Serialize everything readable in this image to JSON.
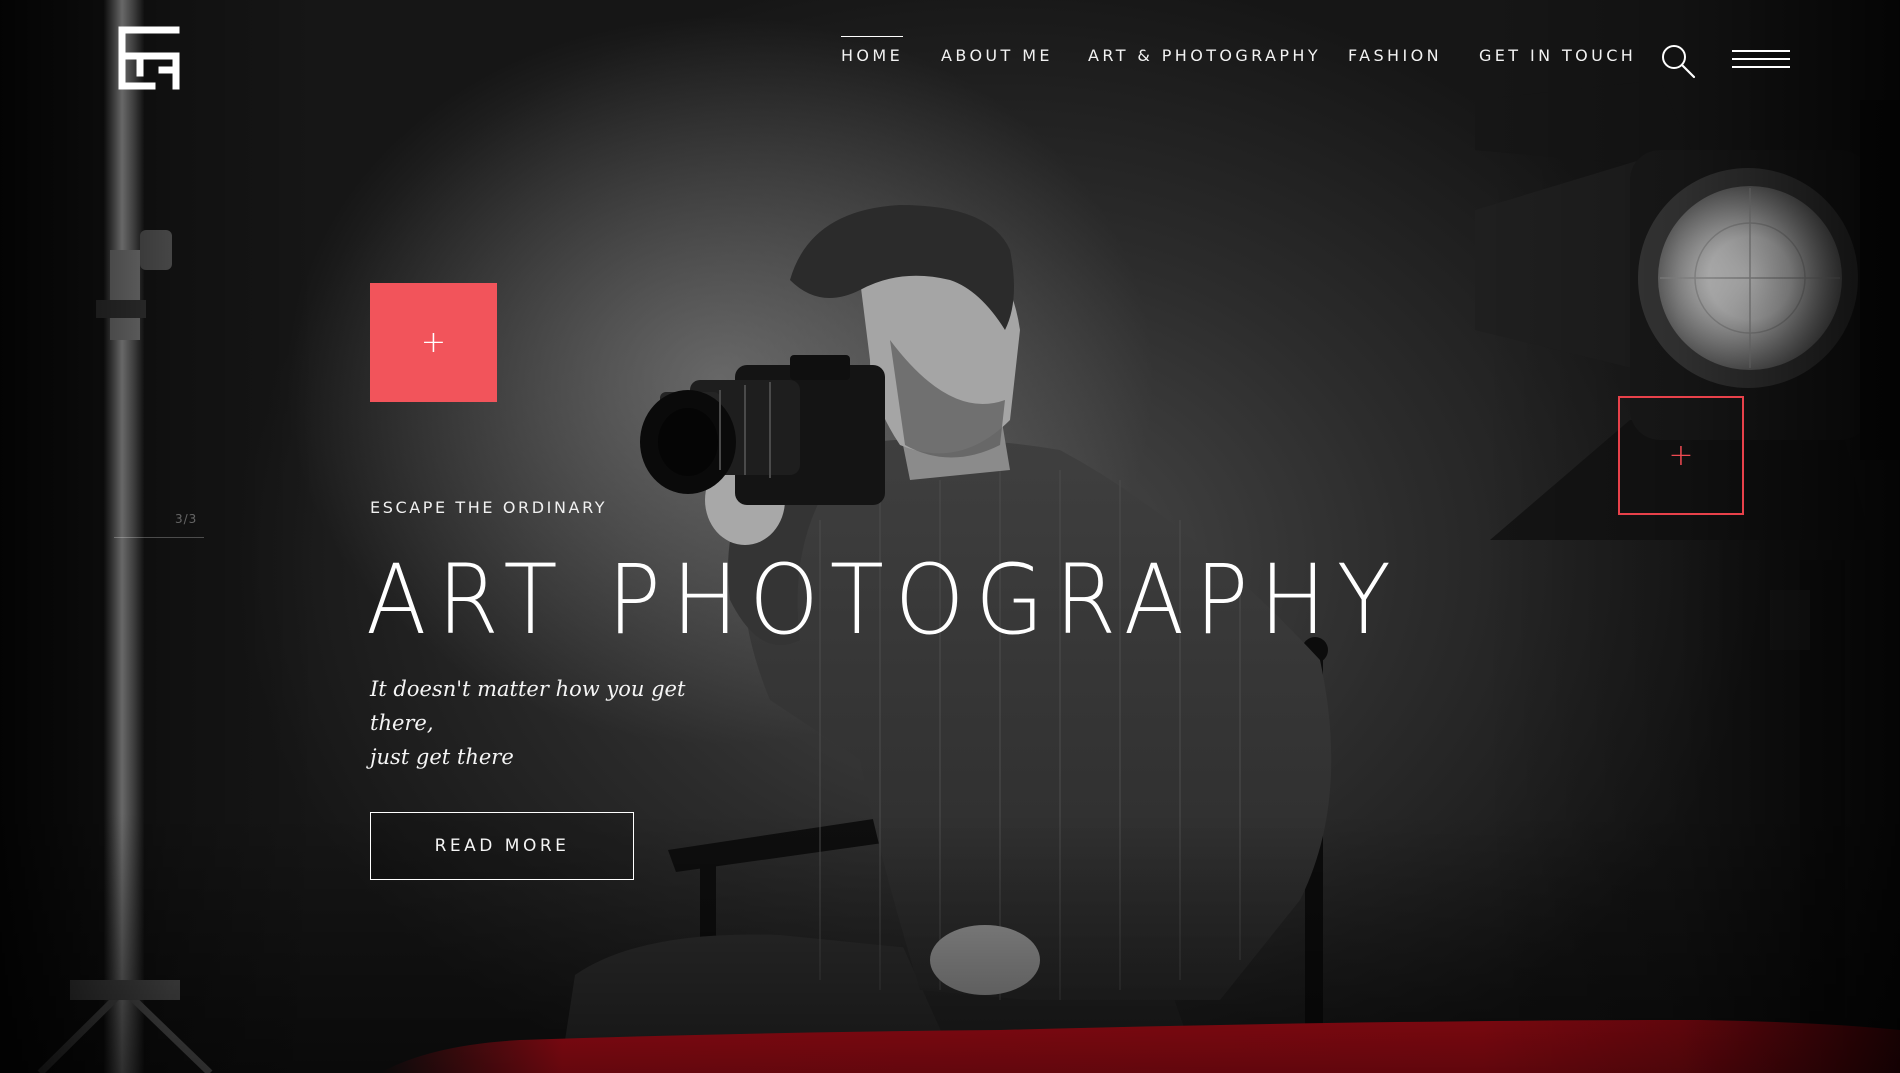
{
  "site": {
    "logo_icon": "brand-monogram-logo"
  },
  "nav": {
    "items": [
      {
        "label": "HOME",
        "active": true
      },
      {
        "label": "ABOUT ME",
        "active": false
      },
      {
        "label": "ART & PHOTOGRAPHY",
        "active": false
      },
      {
        "label": "FASHION",
        "active": false
      },
      {
        "label": "GET IN TOUCH",
        "active": false
      }
    ],
    "search_icon": "search-icon",
    "menu_icon": "hamburger-menu-icon"
  },
  "slider": {
    "counter": "3/3"
  },
  "hero": {
    "plus_label": "+",
    "eyebrow": "ESCAPE THE ORDINARY",
    "headline": "ART PHOTOGRAPHY",
    "tagline_line1": "It doesn't matter how you get there,",
    "tagline_line2": "just get there",
    "cta_label": "READ MORE",
    "secondary_plus_label": "+"
  },
  "colors": {
    "accent": "#f2545b",
    "accent_outline": "#e8414a",
    "paint_stroke": "#e0101e"
  }
}
